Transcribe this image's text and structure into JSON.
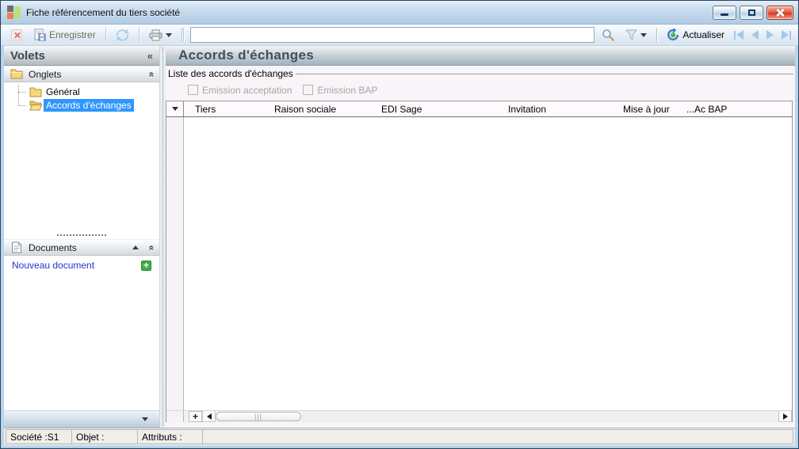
{
  "window": {
    "title": "Fiche référencement du tiers société"
  },
  "colors": {
    "selection_blue": "#2e97fd",
    "link_blue": "#2336c9",
    "plus_green": "#3fae49",
    "close_red": "#d8442c",
    "titlebar_blue": "#b2cce4"
  },
  "icons": {
    "collapse_left_glyph": "«",
    "collapse_up_glyph": "«",
    "grip_glyph": "|||",
    "plus_glyph": "+"
  },
  "toolbar": {
    "save_label": "Enregistrer",
    "refresh_label": "Actualiser",
    "search": {
      "value": ""
    }
  },
  "sidebar": {
    "title": "Volets",
    "panels": {
      "onglets": {
        "title": "Onglets",
        "items": [
          {
            "label": "Général",
            "selected": false
          },
          {
            "label": "Accords d'échanges",
            "selected": true
          }
        ]
      },
      "documents": {
        "title": "Documents",
        "new_document_label": "Nouveau document"
      }
    }
  },
  "main": {
    "title": "Accords d'échanges",
    "group_label": "Liste des accords d'échanges",
    "checkboxes": [
      {
        "label": "Emission acceptation",
        "checked": false,
        "disabled": true
      },
      {
        "label": "Emission BAP",
        "checked": false,
        "disabled": true
      }
    ],
    "table": {
      "columns": [
        "Tiers",
        "Raison sociale",
        "EDI Sage",
        "Invitation",
        "Mise à jour",
        "...Ac BAP"
      ],
      "rows": []
    }
  },
  "statusbar": {
    "cells": [
      {
        "label": "Société :S1"
      },
      {
        "label": "Objet :"
      },
      {
        "label": "Attributs :"
      },
      {
        "label": ""
      }
    ]
  }
}
